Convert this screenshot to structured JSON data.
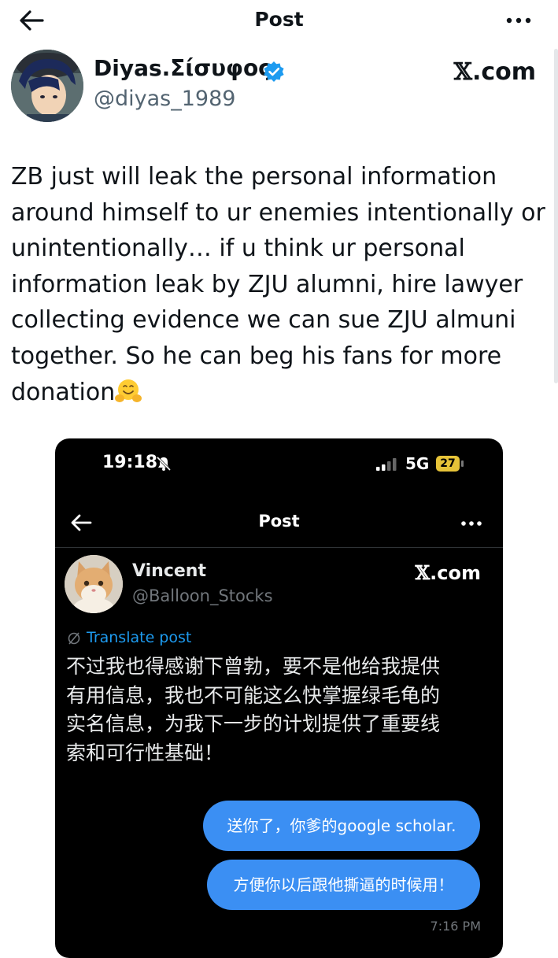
{
  "header": {
    "title": "Post",
    "back_icon": "arrow-left-icon",
    "more_icon": "more-horizontal-icon"
  },
  "author": {
    "display_name": "Diyas.Σίσυφος",
    "handle": "@diyas_1989",
    "verified": true,
    "verified_color": "#1d9bf0"
  },
  "watermark": {
    "x": "𝕏",
    "rest": ".com"
  },
  "post": {
    "lines": [
      "ZB just will leak the personal information",
      "around himself to ur enemies intentionally or",
      "unintentionally… if u think ur personal",
      "information leak by ZJU alumni, hire lawyer",
      "collecting evidence we can sue ZJU almuni",
      "together. So he can beg his fans for more",
      "donation"
    ],
    "emoji": "hugging-face-emoji"
  },
  "embedded": {
    "status_bar": {
      "time": "19:18",
      "network": "5G",
      "battery": "27"
    },
    "header": {
      "title": "Post"
    },
    "author": {
      "display_name": "Vincent",
      "handle": "@Balloon_Stocks"
    },
    "watermark": {
      "x": "𝕏",
      "rest": ".com"
    },
    "translate_label": "Translate post",
    "text_lines": [
      "不过我也得感谢下曾勃，要不是他给我提供",
      "有用信息，我也不可能这么快掌握绿毛龟的",
      "实名信息，为我下一步的计划提供了重要线",
      "索和可行性基础！"
    ],
    "messages": [
      {
        "text": "送你了，你爹的google scholar."
      },
      {
        "text": "方便你以后跟他撕逼的时候用！"
      }
    ],
    "message_time": "7:16 PM",
    "accent_color": "#3b8ff3"
  }
}
